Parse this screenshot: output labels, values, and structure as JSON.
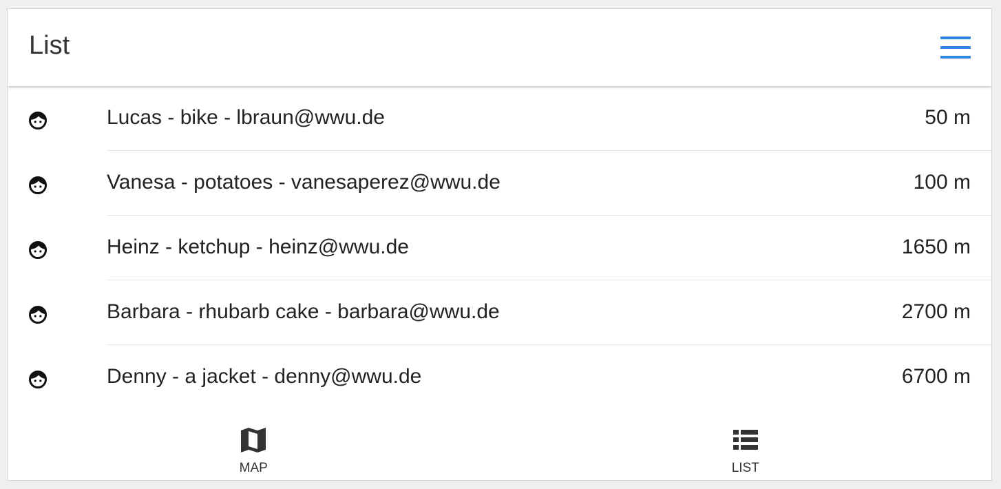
{
  "header": {
    "title": "List",
    "menu_icon": "hamburger-menu-icon",
    "accent_color": "#2e86de"
  },
  "items": [
    {
      "icon": "face-icon",
      "label": "Lucas - bike - lbraun@wwu.de",
      "distance": "50 m"
    },
    {
      "icon": "face-icon",
      "label": "Vanesa - potatoes - vanesaperez@wwu.de",
      "distance": "100 m"
    },
    {
      "icon": "face-icon",
      "label": "Heinz - ketchup - heinz@wwu.de",
      "distance": "1650 m"
    },
    {
      "icon": "face-icon",
      "label": "Barbara - rhubarb cake - barbara@wwu.de",
      "distance": "2700 m"
    },
    {
      "icon": "face-icon",
      "label": "Denny - a jacket - denny@wwu.de",
      "distance": "6700 m"
    }
  ],
  "tabs": [
    {
      "icon": "map-icon",
      "label": "MAP"
    },
    {
      "icon": "list-icon",
      "label": "LIST"
    }
  ]
}
